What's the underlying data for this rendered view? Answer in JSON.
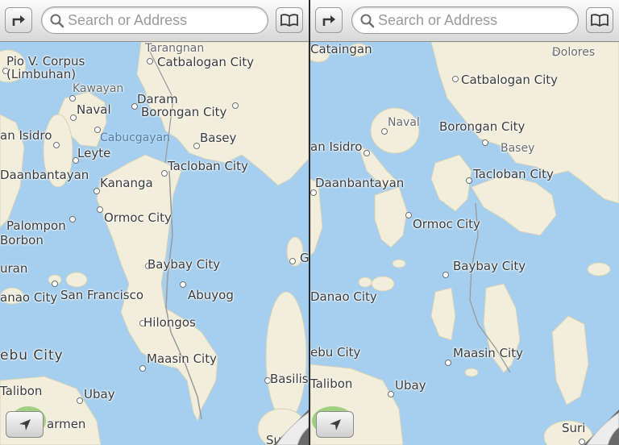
{
  "left_pane": {
    "search_placeholder": "Search or Address",
    "map_labels": {
      "tarangnan": "Tarangnan",
      "pio_v_corpus": "Pio V. Corpus",
      "limbuhan": "(Limbuhan)",
      "catbalogan": "Catbalogan City",
      "kawayan": "Kawayan",
      "daram": "Daram",
      "naval": "Naval",
      "borongan": "Borongan City",
      "san_isidro": "an Isidro",
      "cabucgayan": "Cabucgayan",
      "basey": "Basey",
      "leyte": "Leyte",
      "daanbantayan": "Daanbantayan",
      "tacloban": "Tacloban City",
      "kananga": "Kananga",
      "palompon": "Palompon",
      "ormoc": "Ormoc City",
      "borbon": "Borbon",
      "uran": "uran",
      "baybay": "Baybay City",
      "danao": "anao City",
      "san_francisco": "San Francisco",
      "abuyog": "Abuyog",
      "hilongos": "Hilongos",
      "cebu_city": "ebu City",
      "maasin": "Maasin City",
      "talibon": "Talibon",
      "ubay": "Ubay",
      "carmen": "armen",
      "basilisa": "Basilis",
      "g": "G",
      "su": "Su"
    }
  },
  "right_pane": {
    "search_placeholder": "Search or Address",
    "map_labels": {
      "cataingan": "Cataingan",
      "dolores": "Dolores",
      "catbalogan": "Catbalogan City",
      "naval": "Naval",
      "borongan": "Borongan City",
      "san_isidro": "an Isidro",
      "basey": "Basey",
      "tacloban": "Tacloban City",
      "daanbantayan": "Daanbantayan",
      "ormoc": "Ormoc City",
      "baybay": "Baybay City",
      "danao": "Danao City",
      "cebu_city": "ebu City",
      "maasin": "Maasin City",
      "talibon": "Talibon",
      "ubay": "Ubay",
      "suri": "Suri"
    }
  },
  "icons": {
    "directions": "directions-arrow-icon",
    "bookmarks": "bookmarks-book-icon",
    "search": "search-icon",
    "location": "location-arrow-icon",
    "page_curl": "page-curl-icon"
  },
  "colors": {
    "water": "#a6cfef",
    "land": "#f1eedb",
    "land_green": "#9fcf7f",
    "road": "#9a9a9a"
  }
}
